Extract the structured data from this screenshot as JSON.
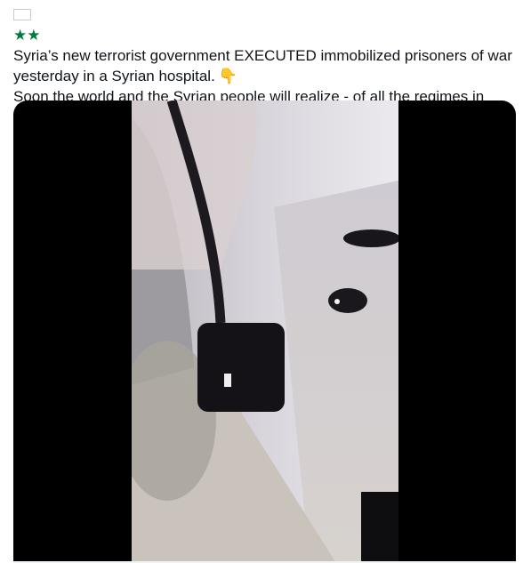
{
  "tweet": {
    "flag_icon": "syria-flag-icon",
    "flag_colors": {
      "top": "#ce1126",
      "middle": "#ffffff",
      "bottom": "#000000",
      "stars": "#007a3d"
    },
    "line1": "Syria’s new terrorist government EXECUTED immobilized prisoners of war yesterday in a Syrian hospital.",
    "pointing_emoji": "👇",
    "line2": "Soon the world and the Syrian people will realize - of all the regimes in Syria, only Assad is the most civilized one."
  },
  "media": {
    "type": "video",
    "watermark_icon": "video-watermark-icon",
    "background_color": "#000000"
  }
}
